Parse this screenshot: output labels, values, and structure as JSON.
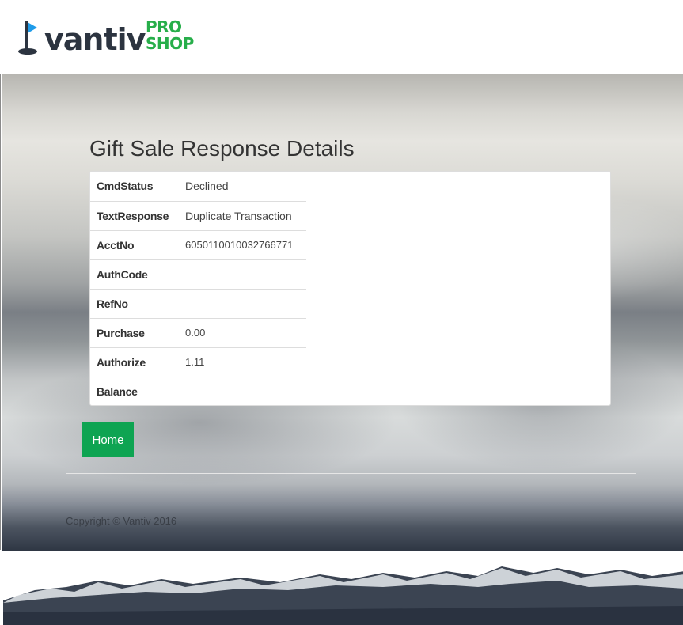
{
  "brand": {
    "name": "vantiv",
    "trademark": "™",
    "sub_line1": "PRO",
    "sub_line2": "SHOP"
  },
  "page": {
    "title": "Gift Sale Response Details"
  },
  "details": [
    {
      "label": "CmdStatus",
      "value": "Declined"
    },
    {
      "label": "TextResponse",
      "value": "Duplicate Transaction"
    },
    {
      "label": "AcctNo",
      "value": "6050110010032766771"
    },
    {
      "label": "AuthCode",
      "value": ""
    },
    {
      "label": "RefNo",
      "value": ""
    },
    {
      "label": "Purchase",
      "value": "0.00"
    },
    {
      "label": "Authorize",
      "value": "1.11"
    },
    {
      "label": "Balance",
      "value": ""
    }
  ],
  "actions": {
    "home_label": "Home"
  },
  "footer": {
    "copyright": "Copyright © Vantiv 2016"
  },
  "colors": {
    "brand_dark": "#2c3440",
    "brand_green": "#27ae4a",
    "flag_blue": "#1e9be9",
    "button_green": "#0ea452"
  },
  "icons": {
    "logo_flag": "golf-flag-icon"
  }
}
